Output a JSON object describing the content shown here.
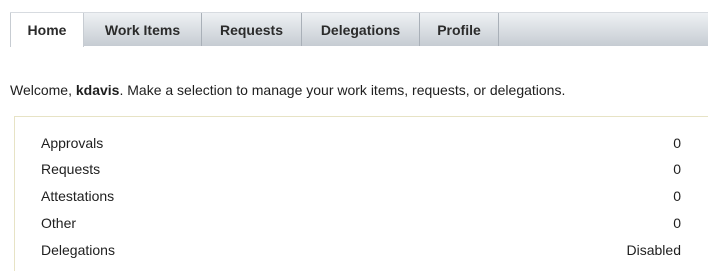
{
  "tabs": [
    {
      "label": "Home",
      "active": true
    },
    {
      "label": "Work Items",
      "active": false
    },
    {
      "label": "Requests",
      "active": false
    },
    {
      "label": "Delegations",
      "active": false
    },
    {
      "label": "Profile",
      "active": false
    }
  ],
  "welcome": {
    "prefix": "Welcome, ",
    "username": "kdavis",
    "suffix": ". Make a selection to manage your work items, requests, or delegations."
  },
  "summary": [
    {
      "label": "Approvals",
      "value": "0"
    },
    {
      "label": "Requests",
      "value": "0"
    },
    {
      "label": "Attestations",
      "value": "0"
    },
    {
      "label": "Other",
      "value": "0"
    },
    {
      "label": "Delegations",
      "value": "Disabled"
    }
  ]
}
